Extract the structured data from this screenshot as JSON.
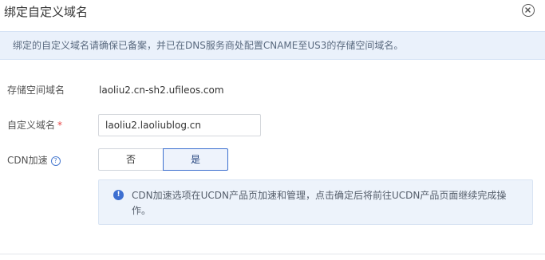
{
  "dialog": {
    "title": "绑定自定义域名",
    "notice": "绑定的自定义域名请确保已备案，并已在DNS服务商处配置CNAME至US3的存储空间域名。"
  },
  "form": {
    "bucket_domain_label": "存储空间域名",
    "bucket_domain_value": "laoliu2.cn-sh2.ufileos.com",
    "custom_domain_label": "自定义域名",
    "required_mark": "*",
    "custom_domain_value": "laoliu2.laoliublog.cn",
    "cdn_label": "CDN加速",
    "cdn_help_glyph": "?",
    "cdn_options": [
      "否",
      "是"
    ],
    "cdn_selected": "是"
  },
  "info": {
    "icon_glyph": "!",
    "text": "CDN加速选项在UCDN产品页加速和管理，点击确定后将前往UCDN产品页面继续完成操作。"
  },
  "icons": {
    "close": "close-circle-icon",
    "help": "question-circle-icon",
    "info": "info-circle-icon"
  },
  "colors": {
    "accent": "#3c6fcf",
    "notice_bg": "#eaf1fb",
    "required": "#e64545"
  }
}
